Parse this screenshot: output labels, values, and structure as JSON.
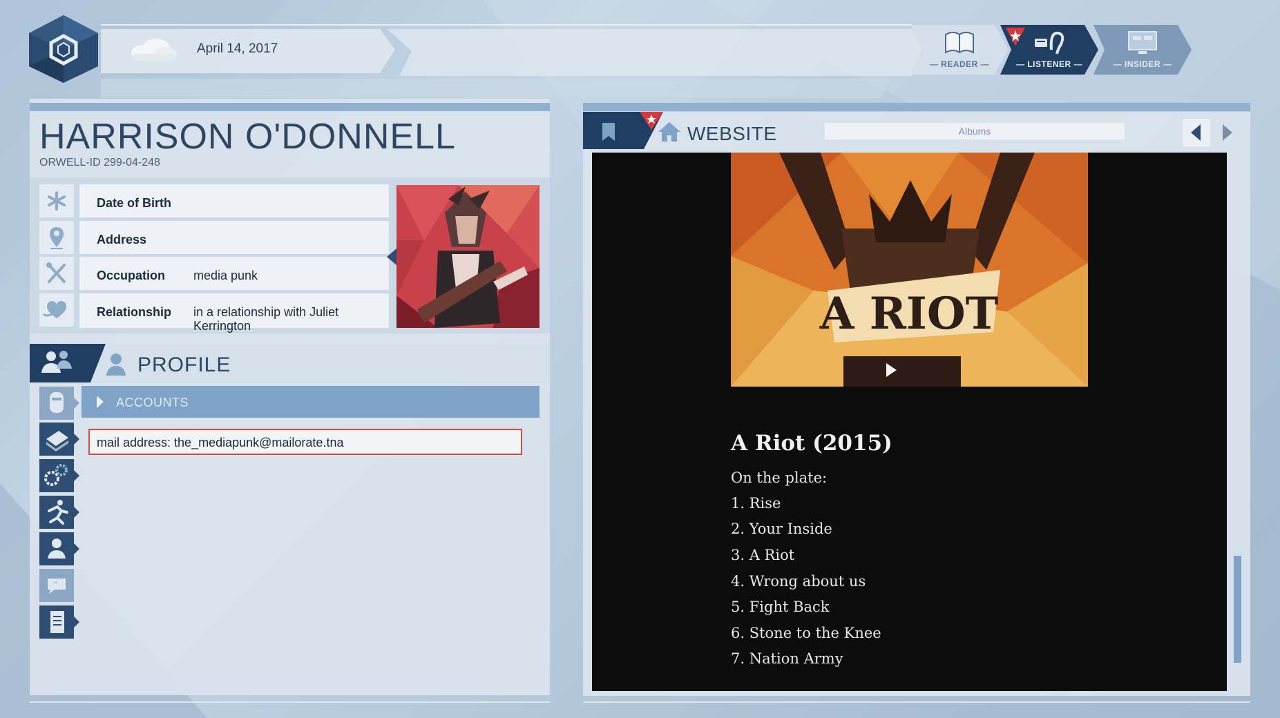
{
  "header": {
    "date": "April 14, 2017",
    "tabs": [
      {
        "label": "— READER —",
        "icon": "book-icon",
        "active": false
      },
      {
        "label": "— LISTENER —",
        "icon": "ear-icon",
        "active": true
      },
      {
        "label": "— INSIDER —",
        "icon": "monitor-icon",
        "active": false
      }
    ]
  },
  "person": {
    "name": "HARRISON O'DONNELL",
    "orwell_id": "ORWELL-ID  299-04-248",
    "fields": [
      {
        "label": "Date of Birth",
        "value": "",
        "icon": "asterisk-icon"
      },
      {
        "label": "Address",
        "value": "",
        "icon": "location-pin-icon"
      },
      {
        "label": "Occupation",
        "value": "media punk",
        "icon": "tools-icon"
      },
      {
        "label": "Relationship",
        "value": "in a relationship with Juliet Kerrington",
        "icon": "heart-icon"
      }
    ]
  },
  "profile": {
    "title": "PROFILE",
    "section": "ACCOUNTS",
    "entry": "mail address: the_mediapunk@mailorate.tna"
  },
  "website": {
    "title": "WEBSITE",
    "url": "Albums",
    "album_art_text": "A RIOT",
    "album_title": "A Riot (2015)",
    "intro": "On the plate:",
    "tracks": [
      "1. Rise",
      "2. Your Inside",
      "3. A Riot",
      "4. Wrong about us",
      "5. Fight Back",
      "6. Stone to the Knee",
      "7. Nation Army"
    ]
  },
  "colors": {
    "accent_dark": "#1f3e62",
    "accent_light": "#7ea3c6",
    "alert_red": "#d84a40",
    "site_background": "#0c0c0c"
  }
}
